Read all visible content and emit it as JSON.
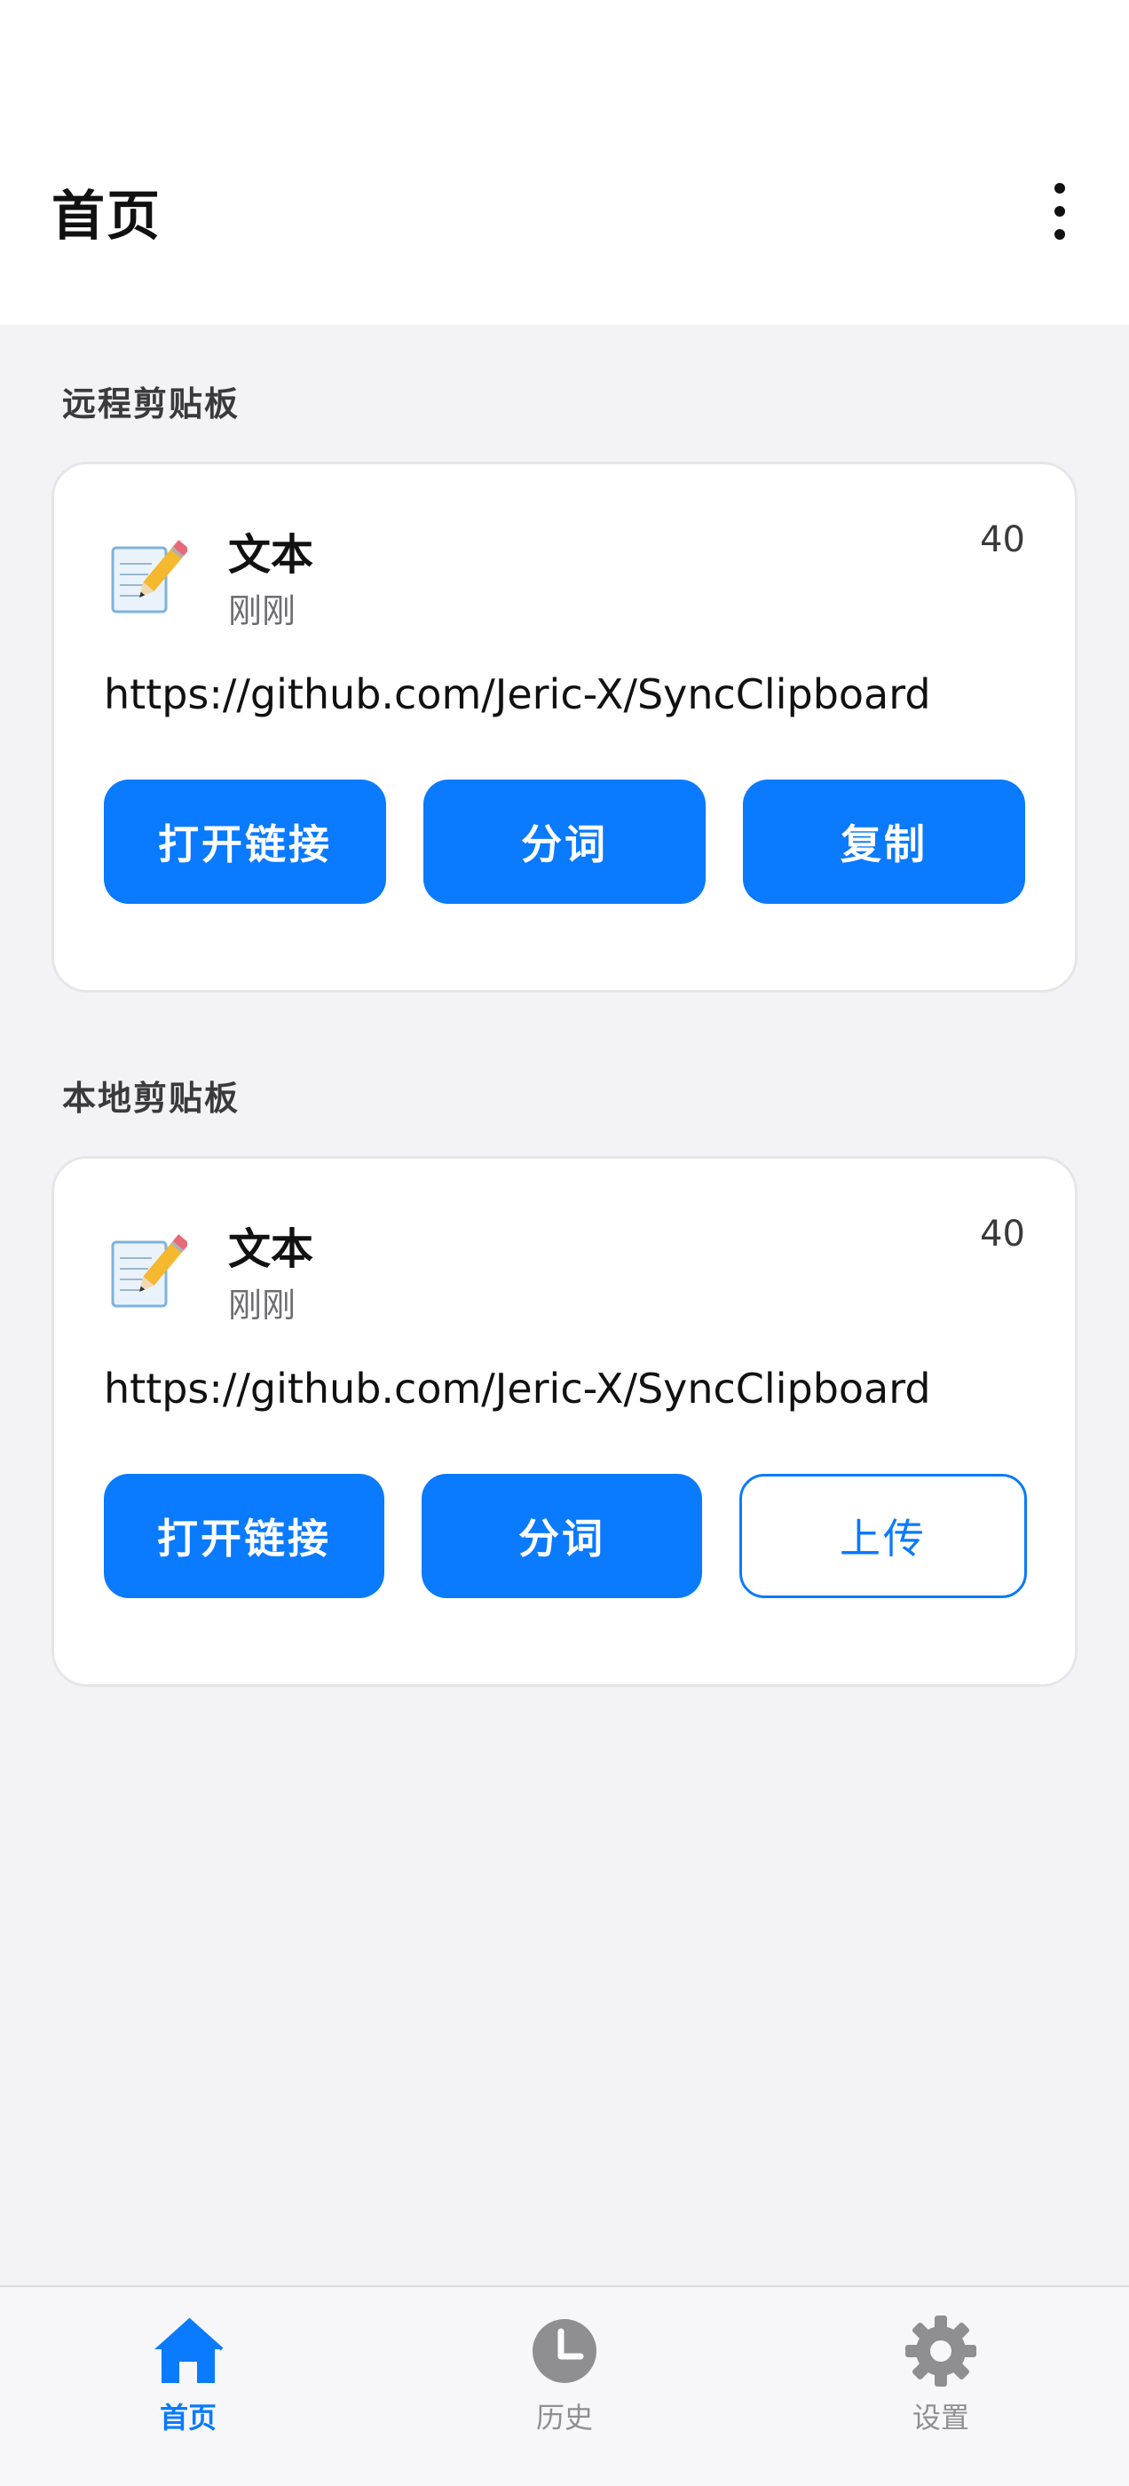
{
  "header": {
    "title": "首页"
  },
  "remote": {
    "section_label": "远程剪贴板",
    "card": {
      "icon": "memo-pencil-icon",
      "type": "文本",
      "time": "刚刚",
      "count": "40",
      "content": "https://github.com/Jeric-X/SyncClipboard",
      "buttons": [
        "打开链接",
        "分词",
        "复制"
      ]
    }
  },
  "local": {
    "section_label": "本地剪贴板",
    "card": {
      "icon": "memo-pencil-icon",
      "type": "文本",
      "time": "刚刚",
      "count": "40",
      "content": "https://github.com/Jeric-X/SyncClipboard",
      "buttons": [
        "打开链接",
        "分词",
        "上传"
      ]
    }
  },
  "nav": {
    "items": [
      {
        "label": "首页",
        "icon": "home-icon",
        "active": true
      },
      {
        "label": "历史",
        "icon": "clock-icon",
        "active": false
      },
      {
        "label": "设置",
        "icon": "gear-icon",
        "active": false
      }
    ]
  },
  "colors": {
    "accent": "#0a7aff",
    "background": "#f2f2f7",
    "card": "#ffffff"
  }
}
